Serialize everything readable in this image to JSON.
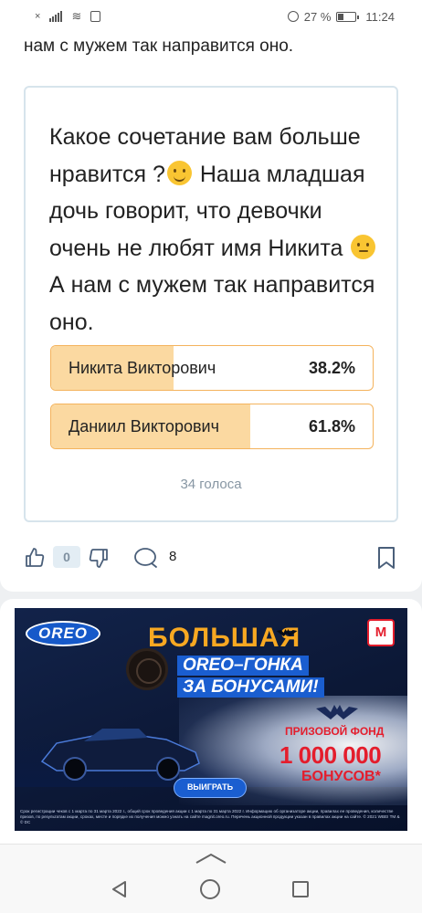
{
  "status_bar": {
    "sim_label": "⅏",
    "battery_percent": "27 %",
    "time": "11:24"
  },
  "post": {
    "truncated_text": "нам с мужем так направится оно.",
    "poll": {
      "question_parts": [
        "Какое сочетание вам больше нравится ?",
        "Наша младшая дочь говорит, что девочки очень не любят имя Никита",
        "А нам с мужем так направится оно."
      ],
      "emoji_1": "smiling-face-icon",
      "emoji_2": "face-with-raised-eyebrow-icon",
      "options": [
        {
          "label": "Никита Викторович",
          "percent": "38.2%",
          "fraction": 0.382
        },
        {
          "label": "Даниил Викторович",
          "percent": "61.8%",
          "fraction": 0.618
        }
      ],
      "votes_label": "34 голоса"
    },
    "actions": {
      "like_count": "0",
      "comment_count": "8",
      "icons": [
        "thumbs-up-icon",
        "thumbs-down-icon",
        "comment-icon",
        "bookmark-icon"
      ]
    }
  },
  "ad": {
    "brand": "OREO",
    "title": "БОЛЬШАЯ",
    "subtitle_line1": "OREO–ГОНКА",
    "subtitle_line2": "ЗА БОНУСАМИ!",
    "store_logo": "М",
    "prize_label": "ПРИЗОВОЙ ФОНД",
    "prize_amount": "1 000 000",
    "prize_unit": "БОНУСОВ*",
    "cta": "ВЫИГРАТЬ",
    "legal": "Срок регистрации чеков с 1 марта по 31 марта 2022 г., общий срок проведения акции с 1 марта по 31 марта 2022 г. Информацию об организаторе акции, правилах ее проведения, количестве призов, по результатам акции, сроках, месте и порядке их получения можно узнать на сайте magnit.oreo.ru. Перечень акционной продукции указан в правилах акции на сайте. © 2021 WBEI TM & © DC"
  },
  "colors": {
    "poll_border": "#d7e4ec",
    "option_border": "#f4b35d",
    "option_fill": "#fbd9a1",
    "votes_text": "#8796a3",
    "ad_bg": "#0c1836",
    "ad_accent": "#f7a822",
    "prize_red": "#e41d2c"
  },
  "navigation": {
    "icons": [
      "swipe-up-icon",
      "back-icon",
      "home-icon",
      "recent-apps-icon"
    ]
  }
}
